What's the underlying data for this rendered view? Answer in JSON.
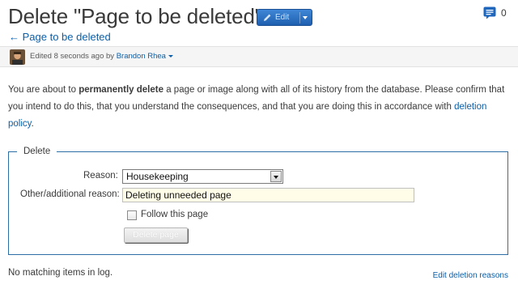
{
  "page": {
    "title": "Delete \"Page to be deleted\"",
    "edit_button_label": "Edit",
    "comments_count": "0",
    "back_link": "← Page to be deleted"
  },
  "edited": {
    "prefix": "Edited 8 seconds ago by",
    "author": "Brandon Rhea"
  },
  "intro": {
    "part1": "You are about to ",
    "bold": "permanently delete",
    "part2": " a page or image along with all of its history from the database. Please confirm that you intend to do this, that you understand the consequences, and that you are doing this in accordance with ",
    "link": "deletion policy",
    "part3": "."
  },
  "form": {
    "legend": "Delete",
    "reason_label": "Reason:",
    "reason_value": "Housekeeping",
    "other_label": "Other/additional reason:",
    "other_value": "Deleting unneeded page",
    "follow_label": "Follow this page",
    "follow_checked": false,
    "delete_button": "Delete page"
  },
  "footer": {
    "no_items": "No matching items in log.",
    "edit_reasons": "Edit deletion reasons"
  },
  "colors": {
    "accent": "#1f5fb0",
    "link": "#0b5ea8",
    "fieldset_border": "#2d6ea6",
    "input_bg": "#fffde8"
  },
  "icons": [
    "pencil-icon",
    "chevron-down-icon",
    "comment-bubble-icon",
    "user-avatar",
    "checkbox-icon"
  ]
}
